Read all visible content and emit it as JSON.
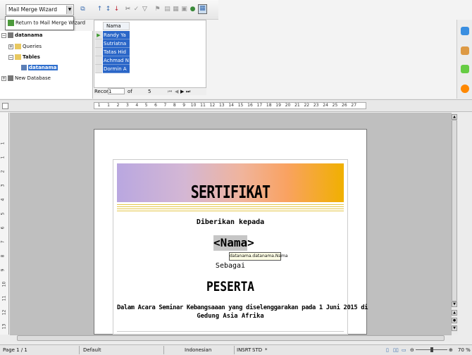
{
  "toolbar": {
    "wizard_select_value": "Mail Merge Wizard",
    "popup_item_label": "Return to Mail Merge Wizard"
  },
  "datasource": {
    "tree": [
      {
        "label": "datanama"
      },
      {
        "label": "Queries"
      },
      {
        "label": "Tables"
      },
      {
        "label": "datanama"
      },
      {
        "label": "New Database"
      }
    ],
    "column_header": "Nama",
    "rows": [
      "Randy Ya",
      "Sutriatna",
      "Tatas Hid",
      "Achmad N",
      "Dormin A"
    ],
    "record_label": "Record",
    "record_current": "1",
    "record_of": "of",
    "record_total": "5"
  },
  "ruler": {
    "marks": [
      "1",
      "1",
      "2",
      "3",
      "4",
      "5",
      "6",
      "7",
      "8",
      "9",
      "10",
      "11",
      "12",
      "13",
      "14",
      "15",
      "16",
      "17",
      "18",
      "19",
      "20",
      "21",
      "22",
      "23",
      "24",
      "25",
      "26",
      "27"
    ]
  },
  "vruler": {
    "marks": [
      "1",
      "1",
      "2",
      "3",
      "4",
      "5",
      "6",
      "7",
      "8",
      "9",
      "10",
      "11",
      "12",
      "13"
    ]
  },
  "document": {
    "title": "SERTIFIKAT",
    "given_to": "Diberikan kepada",
    "field_name": "<Nama>",
    "field_tooltip": "datanama.datanama.Nama",
    "as_label": "Sebagai",
    "role": "PESERTA",
    "event_line1": "Dalam Acara Seminar Kebangsaaan yang diselenggarakan pada 1 Juni 2015 di",
    "event_line2": "Gedung Asia Afrika"
  },
  "statusbar": {
    "page": "Page 1 / 1",
    "style": "Default",
    "language": "Indonesian",
    "insert_mode": "INSRT",
    "selection_mode": "STD",
    "modified": "*",
    "zoom": "70 %"
  },
  "colors": {
    "selection": "#2a66c8",
    "banner_start": "#b9a7e0",
    "banner_end": "#f0b000"
  }
}
